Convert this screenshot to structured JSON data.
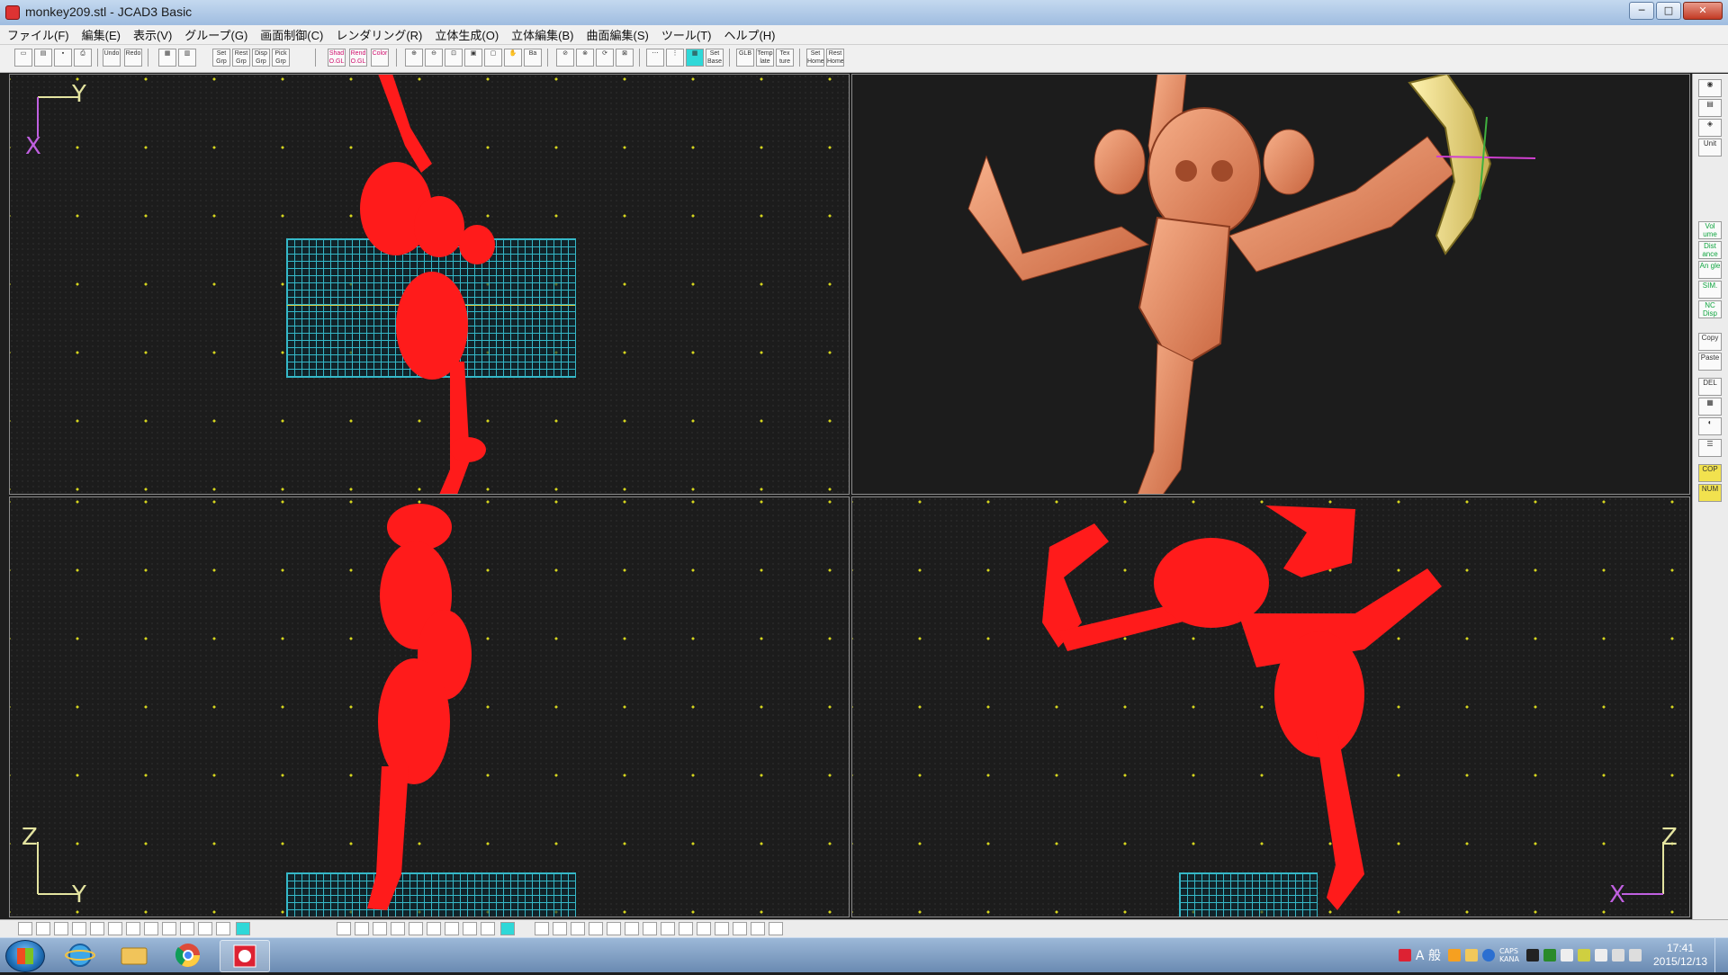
{
  "window": {
    "title": "monkey209.stl - JCAD3 Basic",
    "buttons": [
      "─",
      "□",
      "✕"
    ]
  },
  "menu": [
    "ファイル(F)",
    "編集(E)",
    "表示(V)",
    "グループ(G)",
    "画面制御(C)",
    "レンダリング(R)",
    "立体生成(O)",
    "立体編集(B)",
    "曲面編集(S)",
    "ツール(T)",
    "ヘルプ(H)"
  ],
  "toolbar": {
    "undo": "Undo",
    "redo": "Redo",
    "set_grp": "Set Grp",
    "rest_grp": "Rest Grp",
    "disp_grp": "Disp Grp",
    "pick_grp": "Pick Grp",
    "shad": "Shad O.GL",
    "rend": "Rend O.GL",
    "color": "Color",
    "set_base": "Set Base",
    "glb": "GLB",
    "template": "Temp late",
    "texture": "Tex ture",
    "set_home": "Set Home",
    "rest_home": "Rest Home"
  },
  "right_panel": {
    "unit": "Unit",
    "volume": "Vol ume",
    "distance": "Dist ance",
    "angle": "An gle",
    "sim": "SIM.",
    "nc_disp": "NC Disp",
    "copy": "Copy",
    "paste": "Paste",
    "del": "DEL",
    "cop": "COP",
    "num": "NUM"
  },
  "viewports": {
    "top_left": {
      "axis_v": "X",
      "axis_h": "Y"
    },
    "bottom_left": {
      "axis_v": "Z",
      "axis_h": "Y"
    },
    "bottom_right": {
      "axis_v": "Z",
      "axis_h": "X"
    }
  },
  "colors": {
    "model_wire": "#ff1b1b",
    "model_render": "#e8906a",
    "grid_dot": "#d6d61e",
    "plate": "#35b8c8",
    "banana": "#f0e48a"
  },
  "taskbar": {
    "ime": "A 般",
    "caps": "CAPS",
    "kana": "KANA",
    "time": "17:41",
    "date": "2015/12/13"
  }
}
